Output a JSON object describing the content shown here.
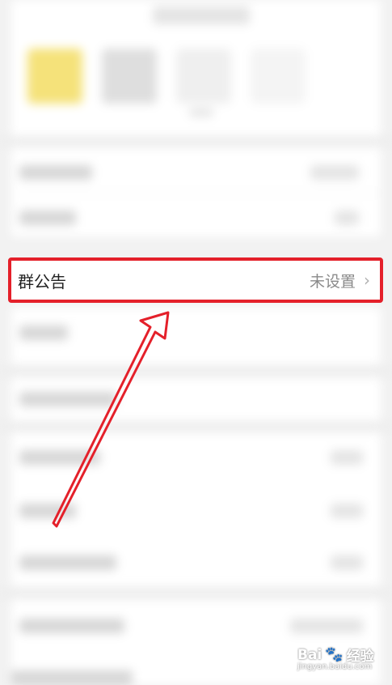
{
  "row": {
    "label": "群公告",
    "value": "未设置",
    "chevron": "›"
  },
  "watermark": {
    "brand": "Bai",
    "paw": "🐾",
    "tail": "经验",
    "sub": "jingyan.baidu.com"
  },
  "colors": {
    "highlight": "#e4202a",
    "annotation_arrow": "#e4202a",
    "background": "#f2f2f2"
  }
}
